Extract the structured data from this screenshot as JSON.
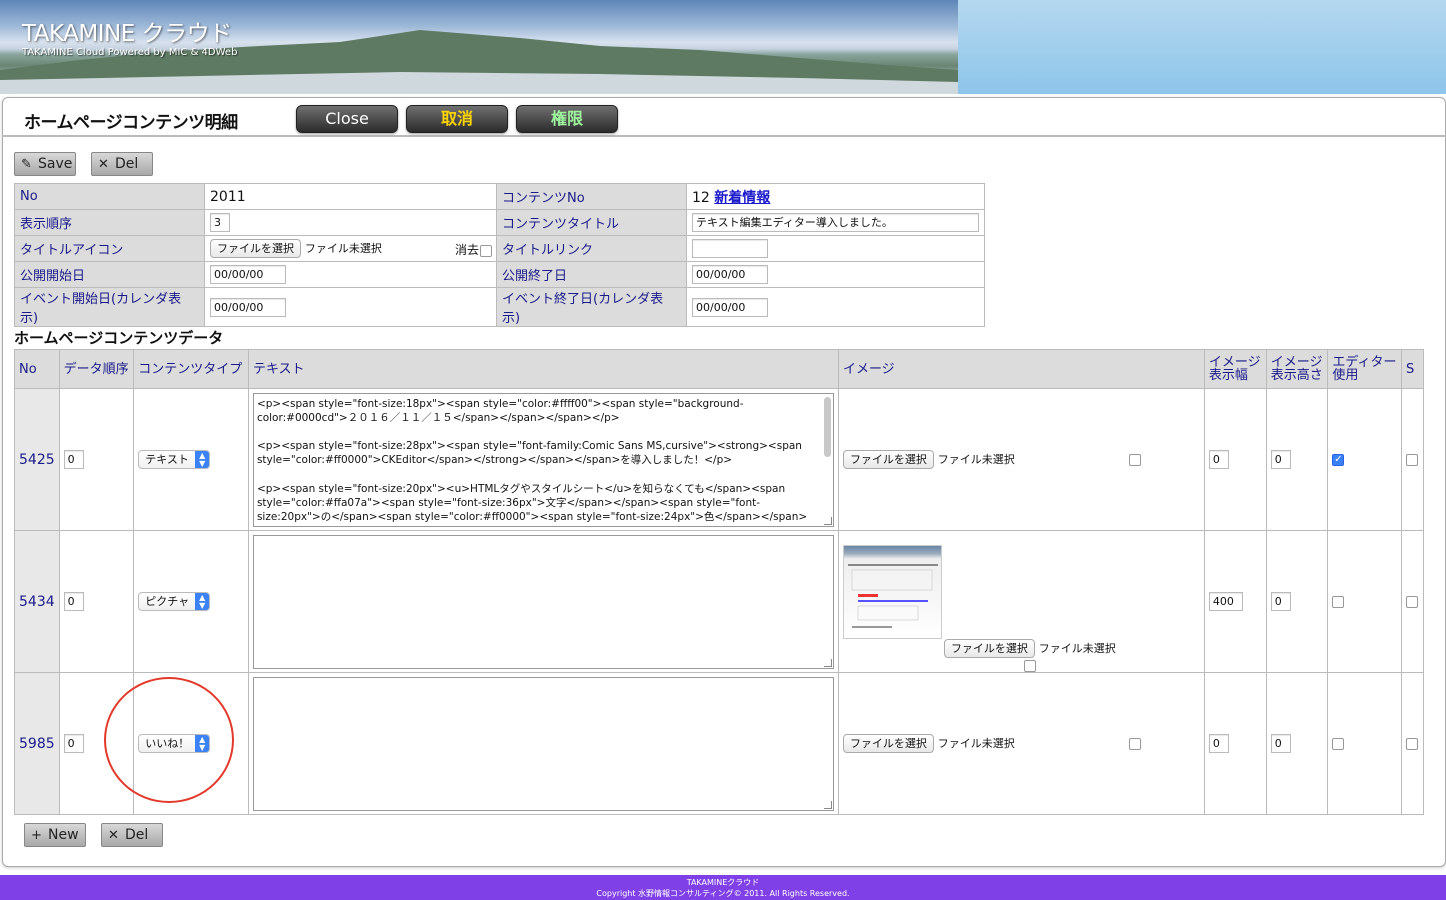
{
  "banner": {
    "title": "TAKAMINE クラウド",
    "subtitle": "TAKAMINE Cloud Powered by MIC & 4DWeb"
  },
  "header": {
    "page_title": "ホームページコンテンツ明細",
    "close_label": "Close",
    "cancel_label": "取消",
    "permission_label": "権限"
  },
  "toolbar": {
    "save_label": "Save",
    "del_label": "Del"
  },
  "form": {
    "no_label": "No",
    "no_value": "2011",
    "content_no_label": "コンテンツNo",
    "content_no_value": "12",
    "content_no_link": "新着情報",
    "order_label": "表示順序",
    "order_value": "3",
    "content_title_label": "コンテンツタイトル",
    "content_title_value": "テキスト編集エディター導入しました。",
    "title_icon_label": "タイトルアイコン",
    "file_button": "ファイルを選択",
    "file_none": "ファイル未選択",
    "erase_label": "消去",
    "title_link_label": "タイトルリンク",
    "title_link_value": "",
    "pub_start_label": "公開開始日",
    "pub_start_value": "00/00/00",
    "pub_end_label": "公開終了日",
    "pub_end_value": "00/00/00",
    "event_start_label": "イベント開始日(カレンダ表示)",
    "event_start_value": "00/00/00",
    "event_end_label": "イベント終了日(カレンダ表示)",
    "event_end_value": "00/00/00"
  },
  "section_title": "ホームページコンテンツデータ",
  "table": {
    "headers": {
      "no": "No",
      "order": "データ順序",
      "type": "コンテンツタイプ",
      "text": "テキスト",
      "image": "イメージ",
      "width": "イメージ表示幅",
      "height": "イメージ表示高さ",
      "editor": "エディター使用",
      "s": "S"
    },
    "file_button": "ファイルを選択",
    "file_none": "ファイル未選択",
    "rows": [
      {
        "no": "5425",
        "order": "0",
        "type": "テキスト",
        "text": "<p><span style=\"font-size:18px\"><span style=\"color:#ffff00\"><span style=\"background-color:#0000cd\">２０１６／１１／１５</span></span></span></p>\n\n<p><span style=\"font-size:28px\"><span style=\"font-family:Comic Sans MS,cursive\"><strong><span style=\"color:#ff0000\">CKEditor</span></strong></span></span>を導入しました！</p>\n\n<p><span style=\"font-size:20px\"><u>HTMLタグやスタイルシート</u>を知らなくても</span><span style=\"color:#ffa07a\"><span style=\"font-size:36px\">文字</span></span><span style=\"font-size:20px\">の</span><span style=\"color:#ff0000\"><span style=\"font-size:24px\">色</span></span><span style=\"font-",
        "width": "0",
        "height": "0",
        "editor": true
      },
      {
        "no": "5434",
        "order": "0",
        "type": "ピクチャ",
        "text": "",
        "width": "400",
        "height": "0",
        "editor": false
      },
      {
        "no": "5985",
        "order": "0",
        "type": "いいね！",
        "text": "",
        "width": "0",
        "height": "0",
        "editor": false
      }
    ]
  },
  "bottom": {
    "new_label": "New",
    "del_label": "Del"
  },
  "footer": {
    "line1": "TAKAMINEクラウド",
    "line2": "Copyright 水野情報コンサルティング© 2011. All Rights Reserved."
  }
}
